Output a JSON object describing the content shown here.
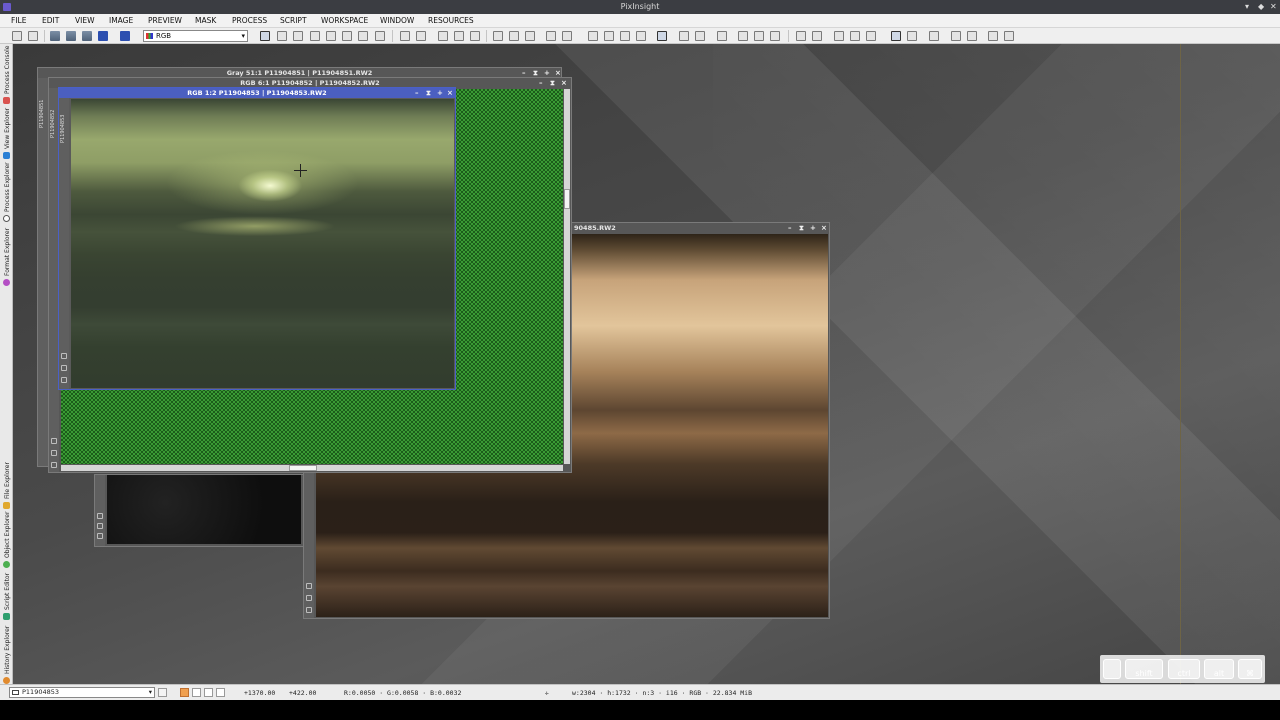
{
  "app": {
    "title": "PixInsight",
    "window_controls": [
      "▾",
      "◆",
      "✕"
    ]
  },
  "menu": [
    "FILE",
    "EDIT",
    "VIEW",
    "IMAGE",
    "PREVIEW",
    "MASK",
    "PROCESS",
    "SCRIPT",
    "WORKSPACE",
    "WINDOW",
    "RESOURCES"
  ],
  "toolbar": {
    "channel_select": "RGB"
  },
  "sidebar_top": [
    {
      "label": "Process Console",
      "icon": "terminal-icon",
      "color": "#d9534f"
    },
    {
      "label": "View Explorer",
      "icon": "view-explorer-icon",
      "color": "#2a7fd4"
    },
    {
      "label": "Process Explorer",
      "icon": "gear-icon",
      "color": "#555555"
    },
    {
      "label": "Format Explorer",
      "icon": "format-icon",
      "color": "#b44fc4"
    }
  ],
  "sidebar_bottom": [
    {
      "label": "File Explorer",
      "icon": "folder-icon",
      "color": "#e0a82e"
    },
    {
      "label": "Object Explorer",
      "icon": "object-icon",
      "color": "#4caf50"
    },
    {
      "label": "Script Editor",
      "icon": "script-icon",
      "color": "#2e9f6e"
    },
    {
      "label": "History Explorer",
      "icon": "history-icon",
      "color": "#e08a2e"
    }
  ],
  "windows": {
    "gray": {
      "title": "Gray 51:1 P11904851 | P11904851.RW2",
      "tab": "P11904851"
    },
    "rgb_61": {
      "title": "RGB 6:1 P11904852 | P11904852.RW2",
      "tab": "P11904852"
    },
    "rgb_12": {
      "title": "RGB 1:2 P11904853 | P11904853.RW2",
      "tab": "P11904853"
    },
    "brown": {
      "title": "90485.RW2"
    }
  },
  "window_buttons": {
    "minimize": "–",
    "shade": "⧗",
    "maximize": "+",
    "close": "×"
  },
  "statusbar": {
    "view": "P11904853",
    "x": "+1370.00",
    "y": "+422.00",
    "values": "R:0.0050 · G:0.0058 · B:0.0032",
    "info": "w:2304 · h:1732 · n:3 · i16 · RGB · 22.834 MiB"
  },
  "keys": [
    "",
    "shift",
    "ctrl",
    "alt",
    "⌘"
  ]
}
